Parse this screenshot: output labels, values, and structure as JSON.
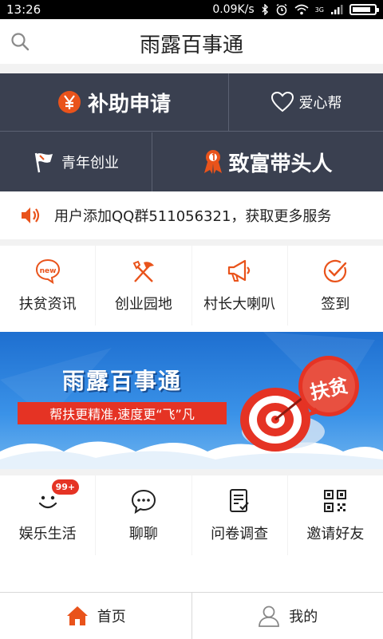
{
  "status_bar": {
    "time": "13:26",
    "speed": "0.09K/s",
    "network": "3G",
    "icons": [
      "bluetooth-icon",
      "alarm-icon",
      "wifi-icon",
      "signal-icon",
      "battery-icon"
    ]
  },
  "header": {
    "title": "雨露百事通",
    "search_icon": "search-icon"
  },
  "tiles": {
    "apply": {
      "label": "补助申请",
      "icon": "yen-icon"
    },
    "love": {
      "label": "爱心帮",
      "icon": "heart-icon"
    },
    "youth": {
      "label": "青年创业",
      "icon": "flag-icon"
    },
    "leader": {
      "label": "致富带头人",
      "icon": "ribbon-medal-icon"
    }
  },
  "notice": {
    "text": "用户添加QQ群511056321，获取更多服务",
    "icon": "speaker-icon"
  },
  "grid_top": [
    {
      "label": "扶贫资讯",
      "icon": "new-bubble-icon",
      "badge_text": "new"
    },
    {
      "label": "创业园地",
      "icon": "tools-icon"
    },
    {
      "label": "村长大喇叭",
      "icon": "megaphone-icon"
    },
    {
      "label": "签到",
      "icon": "check-circle-icon"
    }
  ],
  "banner": {
    "title": "雨露百事通",
    "slogan": "帮扶更精准,速度更“飞”凡",
    "target_label": "扶贫"
  },
  "grid_bottom": [
    {
      "label": "娱乐生活",
      "icon": "smile-icon",
      "badge": "99+"
    },
    {
      "label": "聊聊",
      "icon": "chat-bubble-icon"
    },
    {
      "label": "问卷调查",
      "icon": "survey-icon"
    },
    {
      "label": "邀请好友",
      "icon": "qr-code-icon"
    }
  ],
  "tabbar": [
    {
      "label": "首页",
      "icon": "home-icon"
    },
    {
      "label": "我的",
      "icon": "user-icon"
    }
  ],
  "colors": {
    "accent": "#e9531b",
    "tile_bg": "#3a4050",
    "banner_blue": "#2a7fdc",
    "badge_red": "#e53324"
  }
}
